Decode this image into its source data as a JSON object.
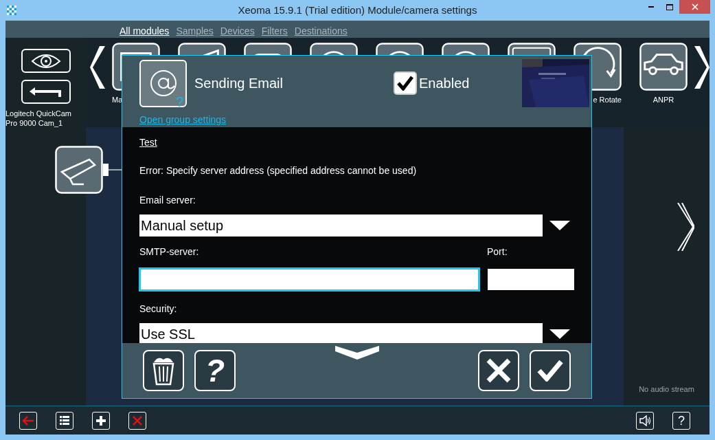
{
  "window": {
    "title": "Xeoma 15.9.1 (Trial edition) Module/camera settings"
  },
  "tabs": [
    {
      "label": "All modules",
      "selected": true
    },
    {
      "label": "Samples",
      "selected": false
    },
    {
      "label": "Devices",
      "selected": false
    },
    {
      "label": "Filters",
      "selected": false
    },
    {
      "label": "Destinations",
      "selected": false
    }
  ],
  "camera": {
    "name": "Logitech QuickCam Pro 9000 Cam_1"
  },
  "modules": [
    {
      "kind": "marking",
      "label": "Ma"
    },
    {
      "kind": "fisheye"
    },
    {
      "kind": "switch"
    },
    {
      "kind": "dial"
    },
    {
      "kind": "dial"
    },
    {
      "kind": "dial"
    },
    {
      "kind": "film"
    },
    {
      "kind": "rotate",
      "label": "e Rotate"
    },
    {
      "kind": "car",
      "label": "ANPR"
    }
  ],
  "dialog": {
    "title": "Sending Email",
    "help_mark": "?",
    "enabled": {
      "label": "Enabled",
      "checked": true
    },
    "group_link": "Open group settings",
    "test_link": "Test",
    "error": "Error: Specify server address (specified address cannot be used)",
    "fields": [
      {
        "kind": "select",
        "label": "Email server:",
        "value": "Manual setup"
      },
      {
        "kind": "server",
        "label": "SMTP-server:",
        "port_label": "Port:"
      },
      {
        "kind": "select",
        "label": "Security:",
        "value": "Use SSL"
      }
    ],
    "help_button": "?"
  },
  "audio_status": "No audio stream",
  "help_button": "?"
}
